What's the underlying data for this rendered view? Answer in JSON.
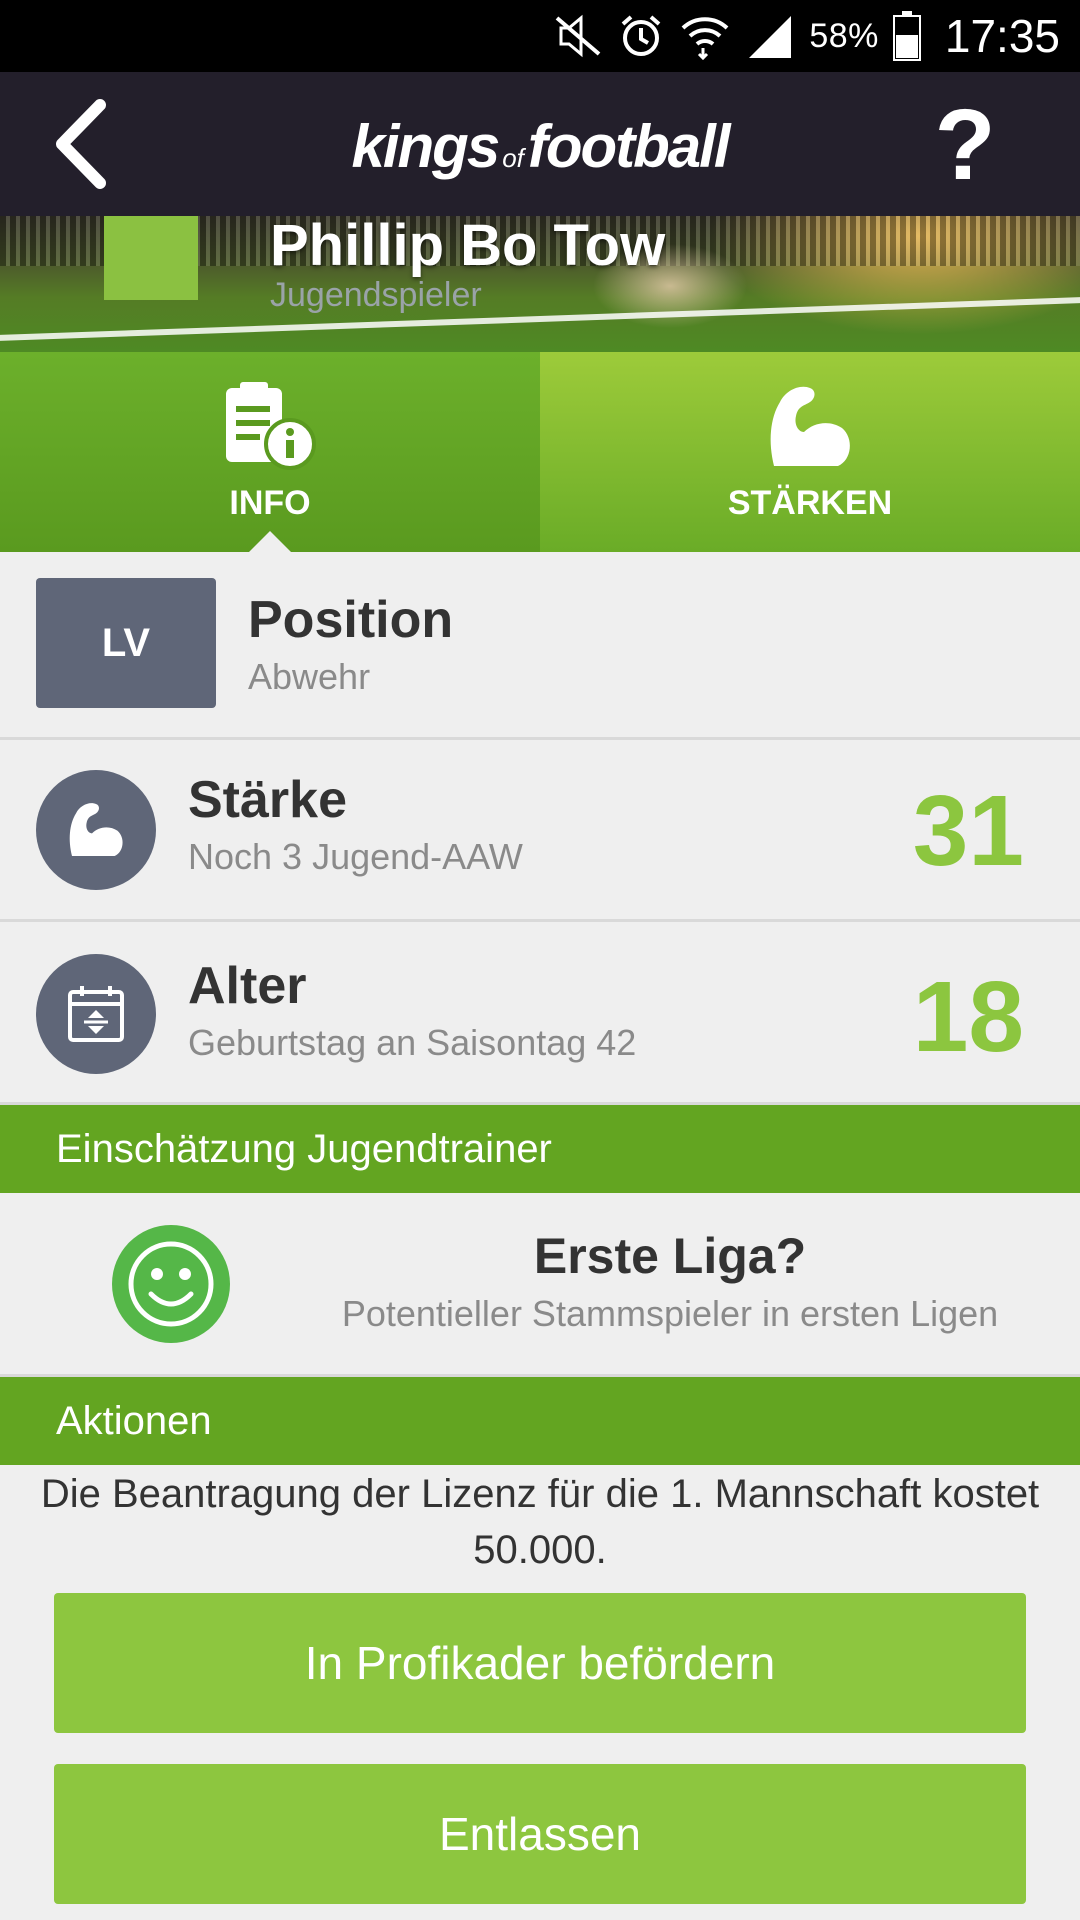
{
  "status_bar": {
    "battery_percent": "58%",
    "time": "17:35",
    "icons": [
      "mute-icon",
      "alarm-icon",
      "wifi-icon",
      "signal-icon",
      "battery-icon"
    ]
  },
  "header": {
    "logo_left": "kings",
    "logo_of": "of",
    "logo_right": "football",
    "help_label": "?"
  },
  "banner": {
    "player_name": "Phillip Bo Tow",
    "player_type": "Jugendspieler"
  },
  "tabs": [
    {
      "label": "INFO",
      "icon": "info-document-icon",
      "active": true
    },
    {
      "label": "STÄRKEN",
      "icon": "flexed-arm-icon",
      "active": false
    }
  ],
  "position": {
    "code": "LV",
    "title": "Position",
    "value": "Abwehr"
  },
  "strength": {
    "title": "Stärke",
    "subtitle": "Noch 3 Jugend-AAW",
    "value": "31"
  },
  "age": {
    "title": "Alter",
    "subtitle": "Geburtstag an Saisontag 42",
    "value": "18"
  },
  "assessment": {
    "section_title": "Einschätzung Jugendtrainer",
    "title": "Erste Liga?",
    "subtitle": "Potentieller Stammspieler in ersten Ligen"
  },
  "actions": {
    "section_title": "Aktionen",
    "info_text": "Die Beantragung der Lizenz für die 1. Mannschaft kostet 50.000.",
    "promote_label": "In Profikader befördern",
    "dismiss_label": "Entlassen"
  },
  "colors": {
    "header_bg": "#231f2b",
    "green_dark": "#63a521",
    "green_light": "#8dc63f",
    "slate": "#5f6678",
    "smile_green": "#55b748"
  }
}
